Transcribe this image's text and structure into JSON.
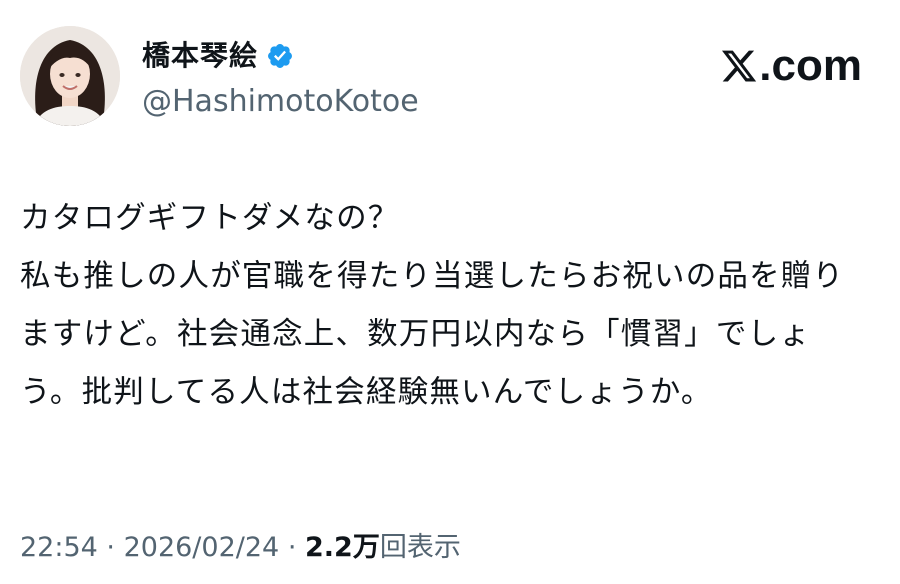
{
  "author": {
    "display_name": "橋本琴絵",
    "handle": "@HashimotoKotoe",
    "verified": true,
    "verified_color": "#1d9bf0"
  },
  "brand": {
    "suffix": ".com",
    "icon": "x-logo-icon"
  },
  "tweet": {
    "lines": [
      "カタログギフトダメなの？",
      "私も推しの人が官職を得たり当選したらお祝いの品を贈りますけど。社会通念上、数万円以内なら「慣習」でしょう。批判してる人は社会経験無いんでしょうか。"
    ]
  },
  "meta": {
    "time": "22:54",
    "separator": "·",
    "date": "2026/02/24",
    "views_count": "2.2万",
    "views_label": "回表示"
  }
}
